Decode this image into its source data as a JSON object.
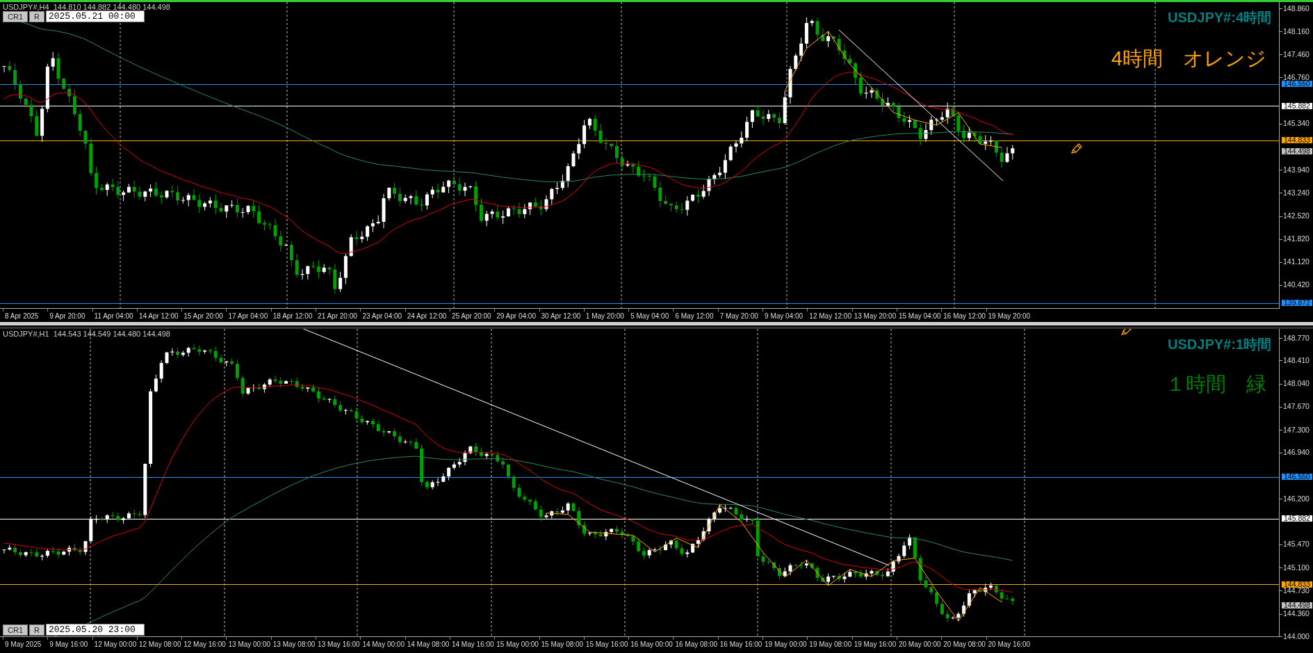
{
  "panes": [
    {
      "active": true,
      "header": "USDJPY#,H4  144.810 144.882 144.480 144.498",
      "buttons": [
        "CR1",
        "R"
      ],
      "date_field": "2025.05.21 00:00",
      "title": "USDJPY#:4時間",
      "note": {
        "text": "4時間　オレンジ",
        "color": "#ffa500"
      },
      "price_ticks": [
        "148.860",
        "148.160",
        "147.460",
        "146.760",
        "145.340",
        "143.940",
        "143.240",
        "142.520",
        "141.820",
        "141.120",
        "140.420"
      ],
      "price_labels": [
        {
          "label": "146.550",
          "color": "#1e90ff",
          "kind": "line"
        },
        {
          "label": "145.882",
          "color": "#ffffff",
          "kind": "line"
        },
        {
          "label": "144.833",
          "color": "#ffa500",
          "kind": "line"
        },
        {
          "label": "144.498",
          "color": "#c0c0c0",
          "kind": "bid"
        },
        {
          "label": "139.872",
          "color": "#1e90ff",
          "kind": "line"
        }
      ],
      "time_labels": [
        "8 Apr 2025",
        "9 Apr 20:00",
        "11 Apr 04:00",
        "14 Apr 12:00",
        "15 Apr 20:00",
        "17 Apr 04:00",
        "18 Apr 12:00",
        "21 Apr 20:00",
        "23 Apr 04:00",
        "24 Apr 12:00",
        "25 Apr 20:00",
        "29 Apr 04:00",
        "30 Apr 12:00",
        "1 May 20:00",
        "5 May 04:00",
        "6 May 12:00",
        "7 May 20:00",
        "9 May 04:00",
        "12 May 12:00",
        "13 May 20:00",
        "15 May 04:00",
        "16 May 12:00",
        "19 May 20:00"
      ]
    },
    {
      "active": false,
      "header": "USDJPY#,H1  144.543 144.549 144.480 144.498",
      "buttons": [
        "CR1",
        "R"
      ],
      "date_field": "2025.05.20 23:00",
      "title": "USDJPY#:1時間",
      "note": {
        "text": "１時間　緑",
        "color": "#008000"
      },
      "price_ticks": [
        "148.770",
        "148.410",
        "148.040",
        "147.670",
        "147.300",
        "146.940",
        "146.200",
        "145.470",
        "145.100",
        "144.730",
        "144.360",
        "144.000"
      ],
      "price_labels": [
        {
          "label": "146.550",
          "color": "#1e90ff",
          "kind": "line"
        },
        {
          "label": "145.882",
          "color": "#ffffff",
          "kind": "line"
        },
        {
          "label": "144.833",
          "color": "#ffa500",
          "kind": "line"
        },
        {
          "label": "144.498",
          "color": "#c0c0c0",
          "kind": "bid"
        }
      ],
      "time_labels": [
        "9 May 2025",
        "9 May 16:00",
        "12 May 00:00",
        "12 May 08:00",
        "12 May 16:00",
        "13 May 00:00",
        "13 May 08:00",
        "13 May 16:00",
        "14 May 00:00",
        "14 May 08:00",
        "14 May 16:00",
        "15 May 00:00",
        "15 May 08:00",
        "15 May 16:00",
        "16 May 00:00",
        "16 May 08:00",
        "16 May 16:00",
        "19 May 00:00",
        "19 May 08:00",
        "19 May 16:00",
        "20 May 00:00",
        "20 May 08:00",
        "20 May 16:00"
      ]
    }
  ]
}
